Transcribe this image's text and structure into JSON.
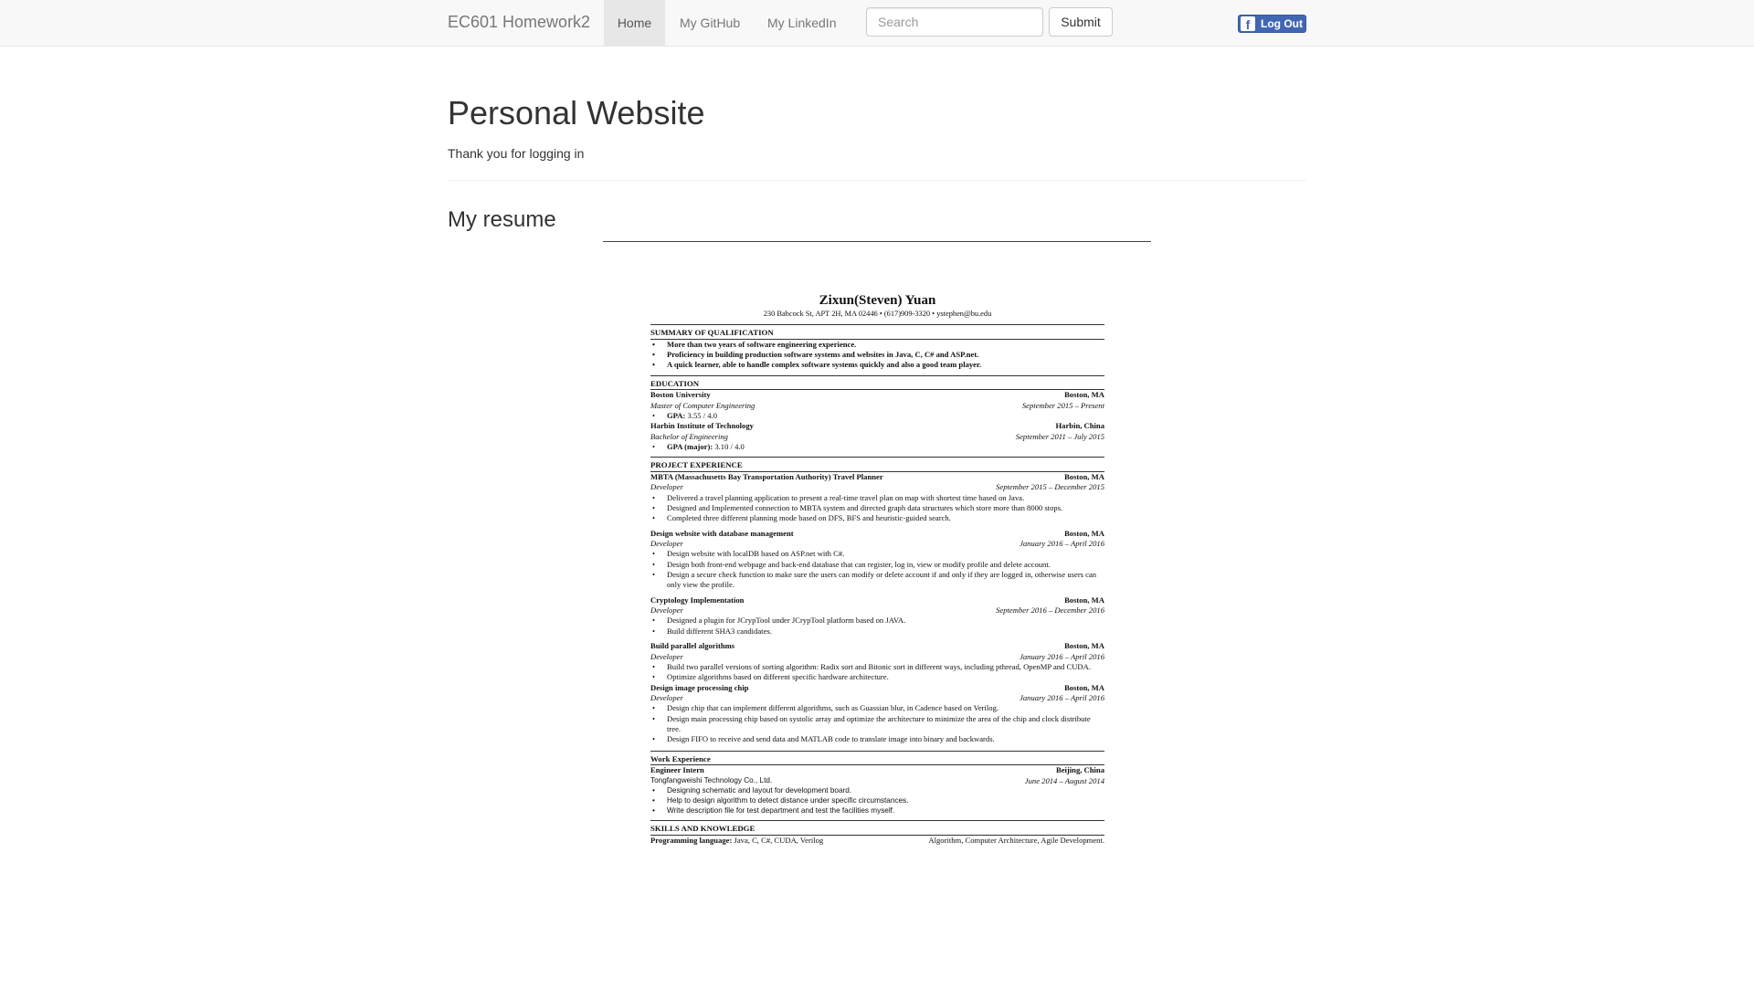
{
  "navbar": {
    "brand": "EC601 Homework2",
    "links": {
      "home": "Home",
      "github": "My GitHub",
      "linkedin": "My LinkedIn"
    },
    "search_placeholder": "Search",
    "submit": "Submit",
    "logout": "Log Out",
    "fb_logo": "f"
  },
  "page": {
    "title": "Personal Website",
    "subtitle": "Thank you for logging in",
    "section_title": "My resume"
  },
  "resume": {
    "name": "Zixun(Steven) Yuan",
    "contact": "230 Babcock St, APT 2H, MA 02446 • (617)909-3320 • ystephen@bu.edu",
    "summary": {
      "heading": "SUMMARY OF QUALIFICATION",
      "items": [
        "More than two years of software engineering experience.",
        "Proficiency in building production software systems and websites in Java, C, C# and ASP.net.",
        "A quick learner, able to handle complex software systems quickly and also a good team player."
      ]
    },
    "education": {
      "heading": "EDUCATION",
      "schools": [
        {
          "name": "Boston University",
          "location": "Boston, MA",
          "degree": "Master of Computer Engineering",
          "dates": "September 2015 – Present",
          "gpa_label": "GPA:",
          "gpa": " 3.55 / 4.0"
        },
        {
          "name": "Harbin Institute of Technology",
          "location": "Harbin, China",
          "degree": "Bachelor of Engineering",
          "dates": "September 2011 – July 2015",
          "gpa_label": "GPA (major):",
          "gpa": " 3.10 / 4.0"
        }
      ]
    },
    "projects": {
      "heading": "PROJECT EXPERIENCE",
      "items": [
        {
          "title": "MBTA (Massachusetts Bay Transportation Authority) Travel Planner",
          "location": "Boston, MA",
          "role": "Developer",
          "dates": "September 2015 – December 2015",
          "bullets": [
            "Delivered a travel planning application to present a real-time travel plan on map with shortest time based on Java.",
            "Designed and Implemented connection to MBTA system and directed graph data structures which store more than 8000 stops.",
            "Completed three different planning mode based on DFS, BFS and heuristic-guided search."
          ]
        },
        {
          "title": "Design website with database management",
          "location": "Boston, MA",
          "role": "Developer",
          "dates": "January 2016 – April 2016",
          "bullets": [
            "Design website with localDB based on ASP.net with C#.",
            "Design both front-end webpage and back-end database that can register, log in, view or modify profile and delete account.",
            "Design a secure check function to make sure the users can modify or delete account if and only if they are logged in, otherwise users can only view the profile."
          ]
        },
        {
          "title": "Cryptology Implementation",
          "location": "Boston, MA",
          "role": "Developer",
          "dates": "September 2016 – December 2016",
          "bullets": [
            "Designed a plugin for JCrypTool under JCrypTool platform based on JAVA.",
            "Build different SHA3 candidates."
          ]
        },
        {
          "title": "Build parallel algorithms",
          "location": "Boston, MA",
          "role": "Developer",
          "dates": "January 2016 – April 2016",
          "bullets": [
            "Build two parallel versions of sorting algorithm: Radix sort and Bitonic sort in different ways, including pthread, OpenMP and CUDA.",
            "Optimize algorithms based on different specific hardware architecture."
          ]
        },
        {
          "title": "Design image processing chip",
          "location": "Boston, MA",
          "role": "Developer",
          "dates": "January 2016 – April 2016",
          "bullets": [
            "Design chip that can implement different algorithms, such as Guassian blur, in Cadence based on Verilog.",
            "Design main processing chip based on systolic array and optimize the architecture to minimize the area of the chip and clock distribute tree.",
            "Design FIFO to receive and send data and MATLAB code to translate image into binary and backwards."
          ]
        }
      ]
    },
    "work": {
      "heading": "Work Experience",
      "title": "Engineer Intern",
      "location": "Beijing, China",
      "company": "Tongfangweishi Technology Co., Ltd.",
      "dates": "June 2014 – August 2014",
      "bullets": [
        "Designing schematic and layout for development board.",
        "Help to design algorithm to detect distance under specific circumstances.",
        "Write description file for test department and test the facilities myself."
      ]
    },
    "skills": {
      "heading": "SKILLS AND KNOWLEDGE",
      "label": "Programming language:",
      "languages": " Java, C, C#, CUDA, Verilog",
      "other": "Algorithm, Computer Architecture, Agile Development."
    }
  }
}
